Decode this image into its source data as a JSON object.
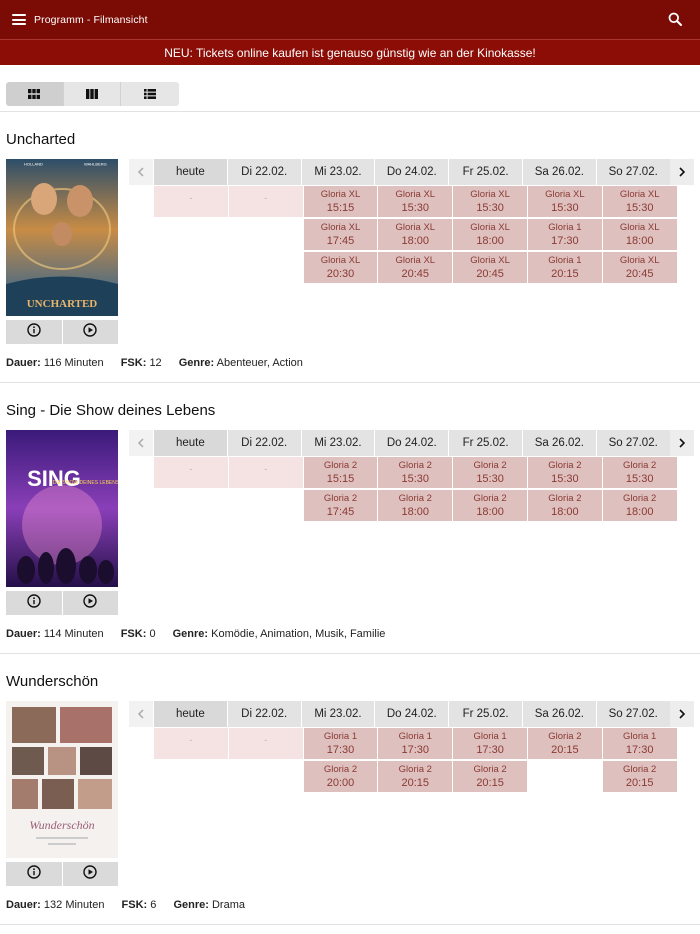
{
  "appbar": {
    "title": "Programm - Filmansicht",
    "menu_icon": "hamburger-menu-icon",
    "search_icon": "search-icon"
  },
  "notice": "NEU: Tickets online kaufen ist genauso günstig wie an der Kinokasse!",
  "view_buttons": [
    {
      "name": "grid-view-icon",
      "active": true
    },
    {
      "name": "columns-view-icon",
      "active": false
    },
    {
      "name": "list-view-icon",
      "active": false
    }
  ],
  "days": [
    "heute",
    "Di 22.02.",
    "Mi 23.02.",
    "Do 24.02.",
    "Fr 25.02.",
    "Sa 26.02.",
    "So 27.02."
  ],
  "labels": {
    "dauer": "Dauer:",
    "fsk": "FSK:",
    "genre": "Genre:",
    "empty_cell": "-"
  },
  "movies": [
    {
      "title": "Uncharted",
      "poster_text": "UNCHARTED",
      "poster_names": [
        "HOLLAND",
        "WAHLBERG"
      ],
      "dauer": "116 Minuten",
      "fsk": "12",
      "genre": "Abenteuer, Action",
      "rows": [
        [
          null,
          null,
          [
            "Gloria XL",
            "15:15"
          ],
          [
            "Gloria XL",
            "15:30"
          ],
          [
            "Gloria XL",
            "15:30"
          ],
          [
            "Gloria XL",
            "15:30"
          ],
          [
            "Gloria XL",
            "15:30"
          ]
        ],
        [
          "x",
          "x",
          [
            "Gloria XL",
            "17:45"
          ],
          [
            "Gloria XL",
            "18:00"
          ],
          [
            "Gloria XL",
            "18:00"
          ],
          [
            "Gloria 1",
            "17:30"
          ],
          [
            "Gloria XL",
            "18:00"
          ]
        ],
        [
          "x",
          "x",
          [
            "Gloria XL",
            "20:30"
          ],
          [
            "Gloria XL",
            "20:45"
          ],
          [
            "Gloria XL",
            "20:45"
          ],
          [
            "Gloria 1",
            "20:15"
          ],
          [
            "Gloria XL",
            "20:45"
          ]
        ]
      ]
    },
    {
      "title": "Sing - Die Show deines Lebens",
      "poster_text": "SING",
      "poster_sub": "DIE SHOW DEINES LEBENS",
      "dauer": "114 Minuten",
      "fsk": "0",
      "genre": "Komödie, Animation, Musik, Familie",
      "rows": [
        [
          null,
          null,
          [
            "Gloria 2",
            "15:15"
          ],
          [
            "Gloria 2",
            "15:30"
          ],
          [
            "Gloria 2",
            "15:30"
          ],
          [
            "Gloria 2",
            "15:30"
          ],
          [
            "Gloria 2",
            "15:30"
          ]
        ],
        [
          "x",
          "x",
          [
            "Gloria 2",
            "17:45"
          ],
          [
            "Gloria 2",
            "18:00"
          ],
          [
            "Gloria 2",
            "18:00"
          ],
          [
            "Gloria 2",
            "18:00"
          ],
          [
            "Gloria 2",
            "18:00"
          ]
        ]
      ]
    },
    {
      "title": "Wunderschön",
      "poster_text": "Wunderschön",
      "dauer": "132 Minuten",
      "fsk": "6",
      "genre": "Drama",
      "rows": [
        [
          null,
          null,
          [
            "Gloria 1",
            "17:30"
          ],
          [
            "Gloria 1",
            "17:30"
          ],
          [
            "Gloria 1",
            "17:30"
          ],
          [
            "Gloria 2",
            "20:15"
          ],
          [
            "Gloria 1",
            "17:30"
          ]
        ],
        [
          "x",
          "x",
          [
            "Gloria 2",
            "20:00"
          ],
          [
            "Gloria 2",
            "20:15"
          ],
          [
            "Gloria 2",
            "20:15"
          ],
          "x",
          [
            "Gloria 2",
            "20:15"
          ]
        ]
      ]
    }
  ]
}
